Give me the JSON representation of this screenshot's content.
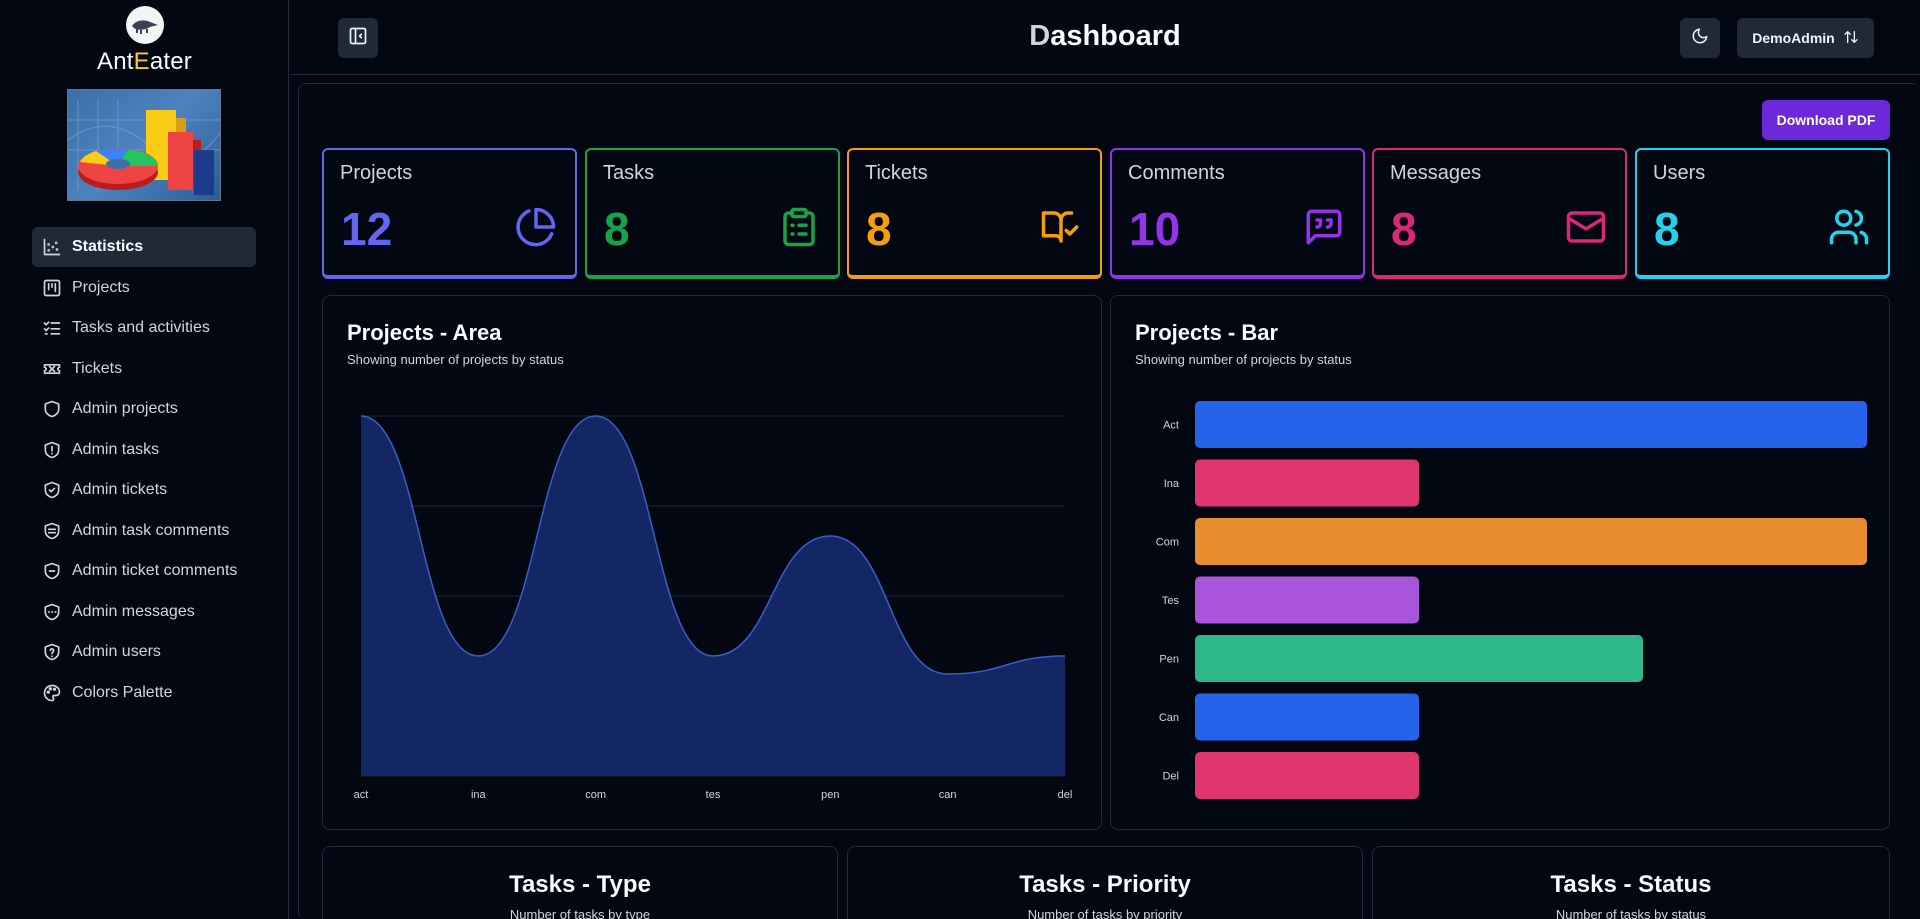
{
  "app": {
    "brand_prefix": "Ant",
    "brand_e": "E",
    "brand_suffix": "ater"
  },
  "sidebar": {
    "items": [
      {
        "label": "Statistics",
        "icon": "chart-scatter-icon",
        "active": true
      },
      {
        "label": "Projects",
        "icon": "kanban-icon"
      },
      {
        "label": "Tasks and activities",
        "icon": "list-checks-icon"
      },
      {
        "label": "Tickets",
        "icon": "ticket-icon"
      },
      {
        "label": "Admin projects",
        "icon": "shield-icon"
      },
      {
        "label": "Admin tasks",
        "icon": "shield-alert-icon"
      },
      {
        "label": "Admin tickets",
        "icon": "shield-check-icon"
      },
      {
        "label": "Admin task comments",
        "icon": "shield-half-icon"
      },
      {
        "label": "Admin ticket comments",
        "icon": "shield-minus-icon"
      },
      {
        "label": "Admin messages",
        "icon": "shield-ellipsis-icon"
      },
      {
        "label": "Admin users",
        "icon": "shield-question-icon"
      },
      {
        "label": "Colors Palette",
        "icon": "palette-icon"
      }
    ]
  },
  "header": {
    "title_first": "D",
    "title_rest": "ashboard",
    "user": "DemoAdmin"
  },
  "toolbar": {
    "download_pdf": "Download PDF"
  },
  "stats": [
    {
      "label": "Projects",
      "value": "12",
      "color": "#6366f1",
      "icon": "pie-chart-icon"
    },
    {
      "label": "Tasks",
      "value": "8",
      "color": "#16a34a",
      "icon": "clipboard-list-icon"
    },
    {
      "label": "Tickets",
      "value": "8",
      "color": "#f59e0b",
      "icon": "book-check-icon"
    },
    {
      "label": "Comments",
      "value": "10",
      "color": "#9333ea",
      "icon": "message-quote-icon"
    },
    {
      "label": "Messages",
      "value": "8",
      "color": "#db2777",
      "icon": "mail-icon"
    },
    {
      "label": "Users",
      "value": "8",
      "color": "#22d3ee",
      "icon": "users-icon"
    }
  ],
  "area_card": {
    "title": "Projects - Area",
    "subtitle": "Showing number of projects by status"
  },
  "bar_card": {
    "title": "Projects - Bar",
    "subtitle": "Showing number of projects by status"
  },
  "bottom_cards": [
    {
      "title": "Tasks - Type",
      "subtitle": "Number of tasks by type"
    },
    {
      "title": "Tasks - Priority",
      "subtitle": "Number of tasks by priority"
    },
    {
      "title": "Tasks - Status",
      "subtitle": "Number of tasks by status"
    }
  ],
  "chart_data": [
    {
      "type": "area",
      "title": "Projects - Area",
      "subtitle": "Showing number of projects by status",
      "categories": [
        "act",
        "ina",
        "com",
        "tes",
        "pen",
        "can",
        "del"
      ],
      "values": [
        3,
        1,
        3,
        1,
        2,
        0.85,
        1
      ],
      "ylim": [
        0,
        3
      ],
      "grid": true,
      "color": "#3b5fc8"
    },
    {
      "type": "bar",
      "orientation": "horizontal",
      "title": "Projects - Bar",
      "subtitle": "Showing number of projects by status",
      "categories": [
        "Act",
        "Ina",
        "Com",
        "Tes",
        "Pen",
        "Can",
        "Del"
      ],
      "values": [
        3,
        1,
        3,
        1,
        2,
        1,
        1
      ],
      "xlim": [
        0,
        3
      ],
      "colors": [
        "#2563eb",
        "#e0356f",
        "#e88c30",
        "#a855db",
        "#2eb88a",
        "#2563eb",
        "#e0356f"
      ]
    }
  ]
}
